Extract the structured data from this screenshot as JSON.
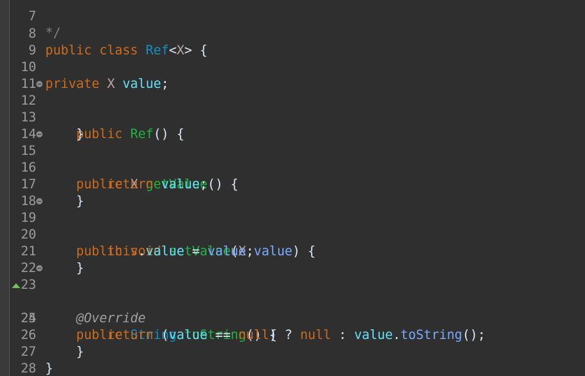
{
  "colors": {
    "background": "#2f2f2f",
    "keyword": "#cc6c1d",
    "type": "#1290c3",
    "field": "#66e1f8",
    "method": "#1eb540",
    "parameter": "#79abff",
    "annotation": "#a0a0a0",
    "line_number": "#9c9c9c"
  },
  "gutter": {
    "top_comment": "*/",
    "top_number": "7"
  },
  "lines": [
    {
      "num": "8",
      "tokens": [
        "public",
        " ",
        "class",
        " ",
        "Ref",
        "<",
        "X",
        "> {"
      ]
    },
    {
      "num": "9"
    },
    {
      "num": "10",
      "tokens": [
        "private",
        " X ",
        "value",
        ";"
      ]
    },
    {
      "num": "11"
    },
    {
      "num": "12",
      "tokens": [
        "    public",
        " ",
        "Ref",
        "() {"
      ]
    },
    {
      "num": "13",
      "tokens": [
        "    }"
      ]
    },
    {
      "num": "14"
    },
    {
      "num": "15",
      "tokens": [
        "    public",
        " ",
        "X",
        " ",
        "getValue",
        "() {"
      ]
    },
    {
      "num": "16",
      "tokens": [
        "        return",
        " ",
        "value",
        ";"
      ]
    },
    {
      "num": "17",
      "tokens": [
        "    }"
      ]
    },
    {
      "num": "18"
    },
    {
      "num": "19",
      "tokens": [
        "    public",
        " ",
        "void",
        " ",
        "setValue",
        "(",
        "X",
        " ",
        "value",
        ") {"
      ]
    },
    {
      "num": "20",
      "tokens": [
        "        this",
        ".",
        "value",
        " = ",
        "value",
        ";"
      ]
    },
    {
      "num": "21",
      "tokens": [
        "    }"
      ]
    },
    {
      "num": "22"
    },
    {
      "num": "23",
      "tokens": [
        "    @Override"
      ]
    },
    {
      "num": "24",
      "tokens": [
        "    public",
        " ",
        "String",
        " ",
        "toString",
        "() {"
      ]
    },
    {
      "num": "25",
      "tokens": [
        "        return",
        " (",
        "value",
        " == ",
        "null",
        ") ? ",
        "null",
        " : ",
        "value",
        ".",
        "toString",
        "();"
      ]
    },
    {
      "num": "26",
      "tokens": [
        "    }"
      ]
    },
    {
      "num": "27",
      "tokens": [
        "}"
      ]
    },
    {
      "num": "28"
    }
  ]
}
